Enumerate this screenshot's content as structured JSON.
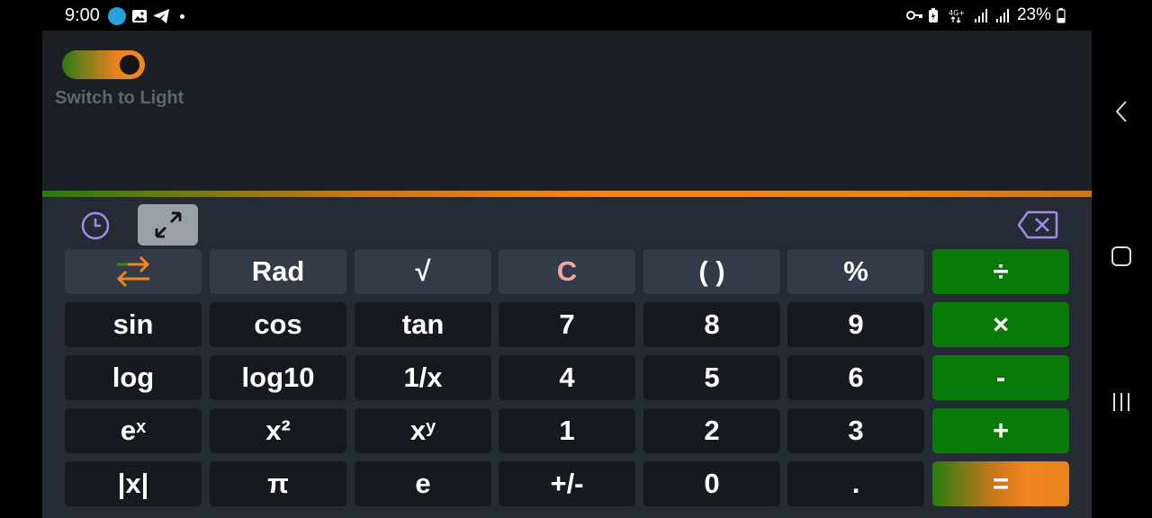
{
  "status_bar": {
    "time": "9:00",
    "battery": "23%",
    "network": "4G+",
    "left_icons": [
      "vpn-key-icon",
      "gallery-icon",
      "telegram-icon",
      "dot-icon"
    ],
    "right_icons": [
      "key-icon",
      "battery-saver-icon",
      "network-4g-icon",
      "signal-icon",
      "signal-icon",
      "battery-icon"
    ]
  },
  "display": {
    "theme_label": "Switch to Light",
    "value": ""
  },
  "toolbar": {
    "icons": [
      "history-icon",
      "expand-icon",
      "backspace-icon"
    ]
  },
  "keypad": {
    "rows": [
      [
        "",
        "Rad",
        "√",
        "C",
        "( )",
        "%",
        "÷"
      ],
      [
        "sin",
        "cos",
        "tan",
        "7",
        "8",
        "9",
        "×"
      ],
      [
        "log",
        "log10",
        "1/x",
        "4",
        "5",
        "6",
        "-"
      ],
      [
        "e^x",
        "x²",
        "x^y",
        "1",
        "2",
        "3",
        "+"
      ],
      [
        "|x|",
        "π",
        "e",
        "+/-",
        "0",
        ".",
        "="
      ]
    ],
    "row0": {
      "rad": "Rad",
      "sqrt": "√",
      "clear": "C",
      "parens": "( )",
      "percent": "%",
      "divide": "÷"
    },
    "row1": {
      "sin": "sin",
      "cos": "cos",
      "tan": "tan",
      "seven": "7",
      "eight": "8",
      "nine": "9",
      "multiply": "×"
    },
    "row2": {
      "log": "log",
      "log10": "log10",
      "reciprocal": "1/x",
      "four": "4",
      "five": "5",
      "six": "6",
      "minus": "-"
    },
    "row3": {
      "exp_base": "e",
      "exp_sup": "x",
      "square": "x²",
      "pow_base": "x",
      "pow_sup": "y",
      "one": "1",
      "two": "2",
      "three": "3",
      "plus": "+"
    },
    "row4": {
      "abs": "|x|",
      "pi": "π",
      "e": "e",
      "negate": "+/-",
      "zero": "0",
      "decimal": ".",
      "equals": "="
    }
  },
  "colors": {
    "background": "#1b1f26",
    "keypad_bg": "#252b35",
    "function_key": "#323b47",
    "number_key": "#161a20",
    "operator_key": "#0a7a0a",
    "accent_orange": "#f0861f",
    "accent_green": "#2a7a12",
    "clear_text": "#f0a6a0",
    "toolbar_icon": "#9d8fe8"
  }
}
